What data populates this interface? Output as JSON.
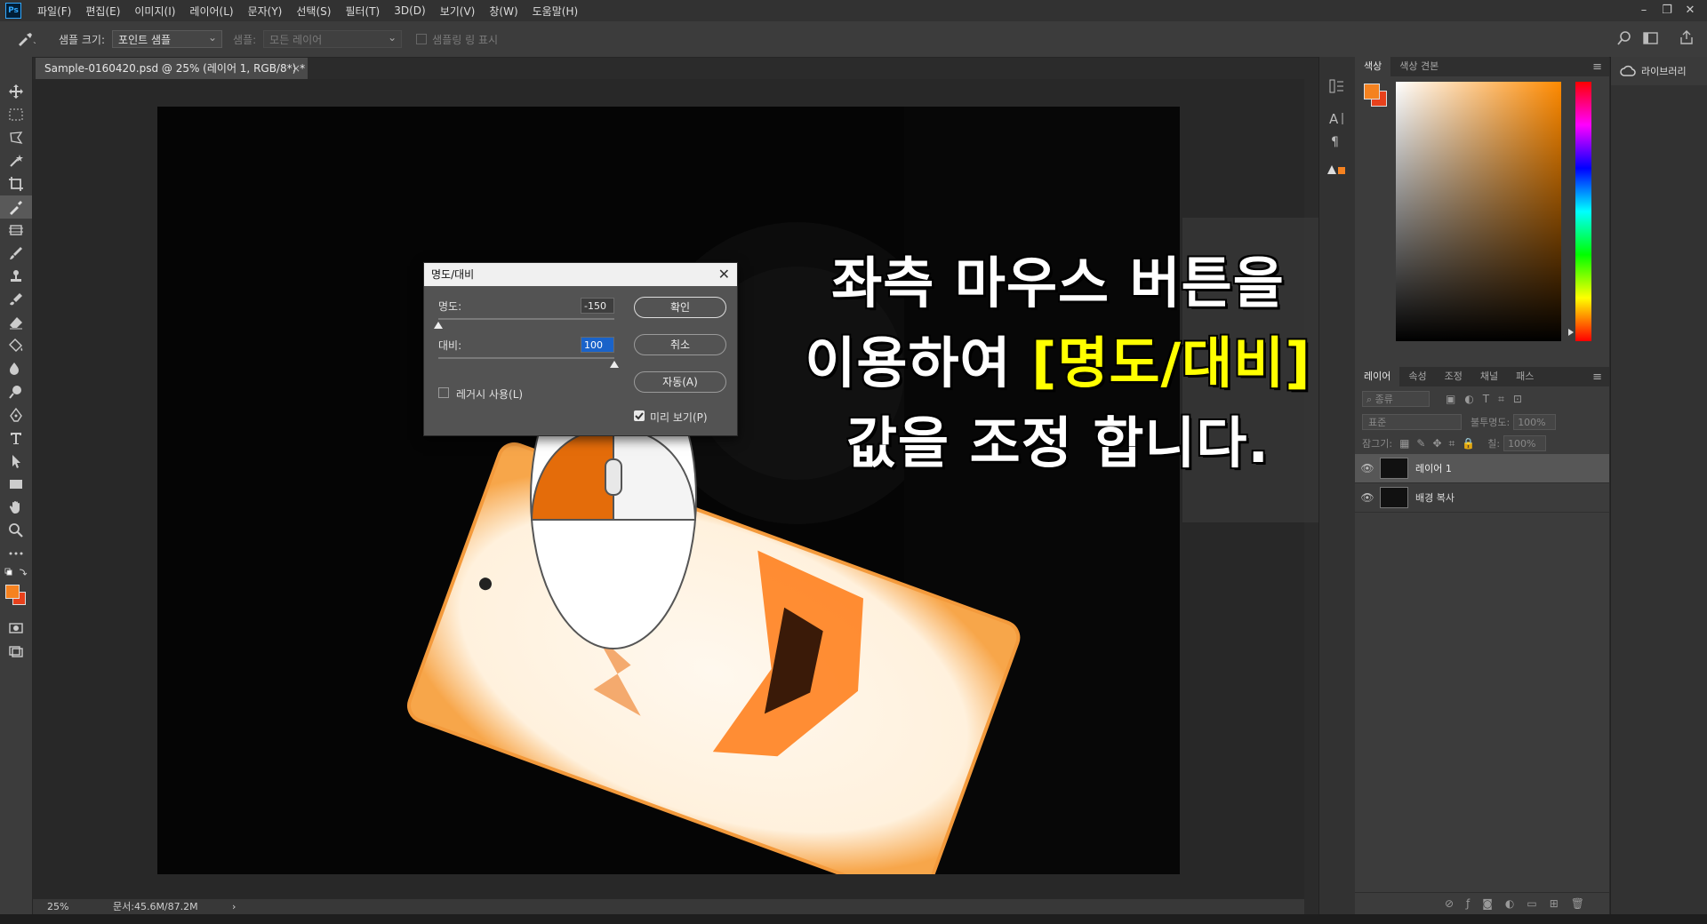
{
  "app": {
    "logo": "Ps"
  },
  "menu": [
    "파일(F)",
    "편집(E)",
    "이미지(I)",
    "레이어(L)",
    "문자(Y)",
    "선택(S)",
    "필터(T)",
    "3D(D)",
    "보기(V)",
    "창(W)",
    "도움말(H)"
  ],
  "window_controls": [
    "–",
    "❐",
    "✕"
  ],
  "options": {
    "sample_size_label": "샘플 크기:",
    "sample_size_value": "포인트 샘플",
    "sample_label": "샘플:",
    "sample_value": "모든 레이어",
    "show_ring_label": "샘플링 링 표시"
  },
  "document": {
    "tab_title": "Sample-0160420.psd @ 25% (레이어 1, RGB/8*) *",
    "close": "×"
  },
  "status": {
    "zoom": "25%",
    "doc_size": "문서:45.6M/87.2M",
    "arrow": "›"
  },
  "dialog": {
    "title": "명도/대비",
    "brightness_label": "명도:",
    "brightness_value": "-150",
    "brightness_fraction": 0.0,
    "contrast_label": "대비:",
    "contrast_value": "100",
    "contrast_fraction": 1.0,
    "legacy_label": "레거시 사용(L)",
    "legacy_checked": false,
    "ok_label": "확인",
    "cancel_label": "취소",
    "auto_label": "자동(A)",
    "preview_label": "미리 보기(P)",
    "preview_checked": true
  },
  "caption": {
    "line1": "좌측 마우스 버튼을",
    "line2_prefix": "이용하여 ",
    "line2_highlight": "[명도/대비]",
    "line3": "값을 조정 합니다."
  },
  "color_panel": {
    "tabs": [
      "색상",
      "색상 견본"
    ],
    "foreground_color": "#f58220",
    "background_color": "#e8411c"
  },
  "layers_panel": {
    "tabs": [
      "레이어",
      "속성",
      "조정",
      "채널",
      "패스"
    ],
    "search_placeholder": "종류",
    "blend_mode": "표준",
    "opacity_label": "불투명도:",
    "opacity_value": "100%",
    "lock_label": "잠그기:",
    "fill_label": "칠:",
    "fill_value": "100%",
    "layers": [
      {
        "name": "레이어 1",
        "selected": true
      },
      {
        "name": "배경 복사",
        "selected": false
      }
    ]
  },
  "libraries": {
    "label": "라이브러리"
  }
}
